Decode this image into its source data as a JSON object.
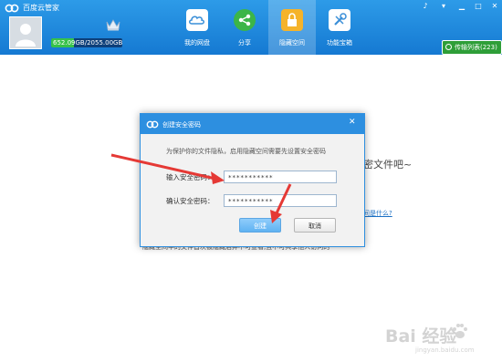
{
  "app": {
    "title": "百度云管家",
    "quota": "652.09GB/2055.00GB",
    "quota_fraction": 0.317
  },
  "nav": [
    {
      "label": "我的网盘",
      "icon": "cloud-icon"
    },
    {
      "label": "分享",
      "icon": "share-icon"
    },
    {
      "label": "隐藏空间",
      "icon": "lock-icon"
    },
    {
      "label": "功能宝箱",
      "icon": "toolbox-icon"
    }
  ],
  "transfer": {
    "label": "传输列表(223)"
  },
  "background": {
    "text1": "密文件吧~",
    "link": "间是什么?",
    "text2": "隐藏空间中的文件首次被隐藏后并不可查看,且不可共享他人访问的"
  },
  "dialog": {
    "title": "创建安全密码",
    "description": "为保护你的文件隐私，启用隐藏空间需要先设置安全密码",
    "password_label": "输入安全密码：",
    "password_value": "***********",
    "confirm_label": "确认安全密码：",
    "confirm_value": "***********",
    "create_label": "创建",
    "cancel_label": "取消"
  },
  "colors": {
    "brand": "#1e88e5",
    "accent": "#e53935",
    "success": "#2e9e38"
  },
  "watermark": {
    "text": "Bai 经验",
    "url": "jingyan.baidu.com"
  }
}
